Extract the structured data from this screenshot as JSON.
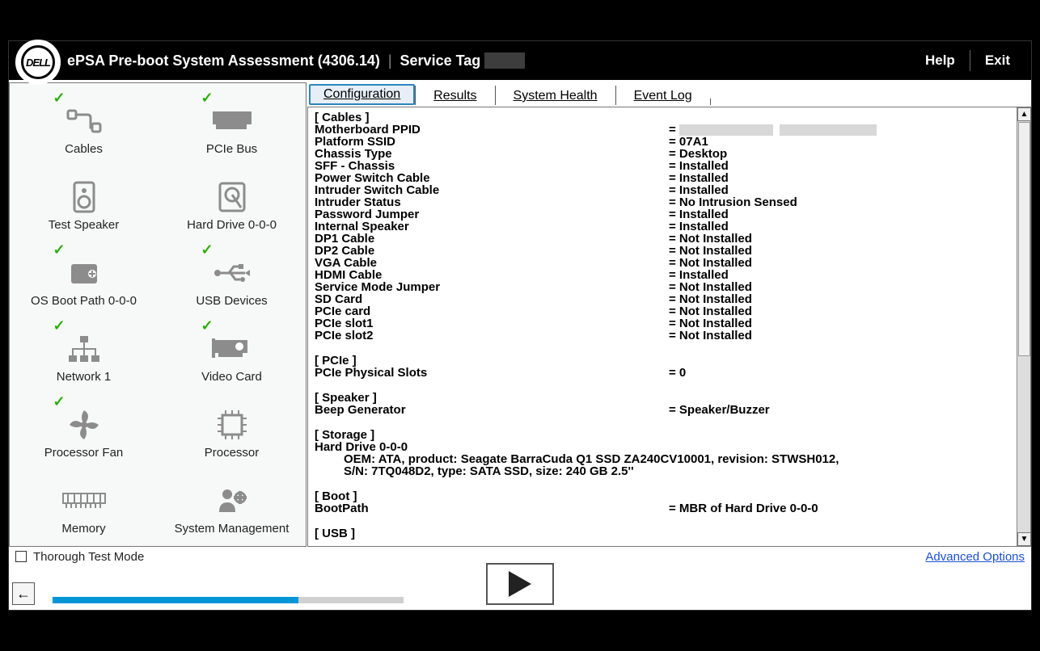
{
  "header": {
    "brand": "DELL",
    "title": "ePSA Pre-boot System Assessment (4306.14)",
    "service_tag_label": "Service Tag",
    "service_tag_value": "",
    "help": "Help",
    "exit": "Exit"
  },
  "devices": [
    {
      "label": "Cables",
      "check": true,
      "icon": "cable-icon"
    },
    {
      "label": "PCIe Bus",
      "check": true,
      "icon": "pcie-icon"
    },
    {
      "label": "Test Speaker",
      "check": false,
      "icon": "speaker-icon"
    },
    {
      "label": "Hard Drive 0-0-0",
      "check": false,
      "icon": "hdd-icon"
    },
    {
      "label": "OS Boot Path 0-0-0",
      "check": true,
      "icon": "boot-icon"
    },
    {
      "label": "USB Devices",
      "check": true,
      "icon": "usb-icon"
    },
    {
      "label": "Network 1",
      "check": true,
      "icon": "network-icon"
    },
    {
      "label": "Video Card",
      "check": true,
      "icon": "video-icon"
    },
    {
      "label": "Processor Fan",
      "check": true,
      "icon": "fan-icon"
    },
    {
      "label": "Processor",
      "check": false,
      "icon": "cpu-icon"
    },
    {
      "label": "Memory",
      "check": false,
      "icon": "memory-icon"
    },
    {
      "label": "System Management",
      "check": false,
      "icon": "sysmgmt-icon"
    }
  ],
  "tabs": {
    "config": "Configuration",
    "results": "Results",
    "health": "System Health",
    "eventlog": "Event Log"
  },
  "config": {
    "sections": [
      {
        "header": "[ Cables ]",
        "rows": [
          {
            "k": "Motherboard PPID",
            "v": "= ",
            "redact": true
          },
          {
            "k": "Platform SSID",
            "v": "= 07A1"
          },
          {
            "k": "Chassis Type",
            "v": "= Desktop"
          },
          {
            "k": "SFF - Chassis",
            "v": "= Installed"
          },
          {
            "k": "Power Switch Cable",
            "v": "= Installed"
          },
          {
            "k": "Intruder Switch Cable",
            "v": "= Installed"
          },
          {
            "k": "Intruder Status",
            "v": "= No Intrusion Sensed"
          },
          {
            "k": "Password Jumper",
            "v": "= Installed"
          },
          {
            "k": "Internal Speaker",
            "v": "= Installed"
          },
          {
            "k": "DP1 Cable",
            "v": "= Not Installed"
          },
          {
            "k": "DP2 Cable",
            "v": "= Not Installed"
          },
          {
            "k": "VGA Cable",
            "v": "= Not Installed"
          },
          {
            "k": "HDMI Cable",
            "v": "= Installed"
          },
          {
            "k": "Service Mode Jumper",
            "v": "= Not Installed"
          },
          {
            "k": "SD Card",
            "v": "= Not Installed"
          },
          {
            "k": "PCIe card",
            "v": "= Not Installed"
          },
          {
            "k": "PCIe slot1",
            "v": "= Not Installed"
          },
          {
            "k": "PCIe slot2",
            "v": "= Not Installed"
          }
        ]
      },
      {
        "header": "[ PCIe ]",
        "rows": [
          {
            "k": "PCIe Physical Slots",
            "v": "= 0"
          }
        ]
      },
      {
        "header": "[ Speaker ]",
        "rows": [
          {
            "k": "Beep Generator",
            "v": "= Speaker/Buzzer"
          }
        ]
      },
      {
        "header": "[ Storage ]",
        "plain": "Hard Drive 0-0-0",
        "indented": [
          "OEM: ATA, product: Seagate BarraCuda Q1 SSD ZA240CV10001, revision: STWSH012,",
          "S/N: 7TQ048D2, type: SATA SSD, size: 240 GB 2.5''"
        ]
      },
      {
        "header": "[ Boot ]",
        "rows": [
          {
            "k": "BootPath",
            "v": "= MBR of Hard Drive 0-0-0"
          }
        ]
      },
      {
        "header": "[ USB ]"
      }
    ]
  },
  "footer": {
    "thorough": "Thorough Test Mode",
    "advanced": "Advanced Options"
  }
}
